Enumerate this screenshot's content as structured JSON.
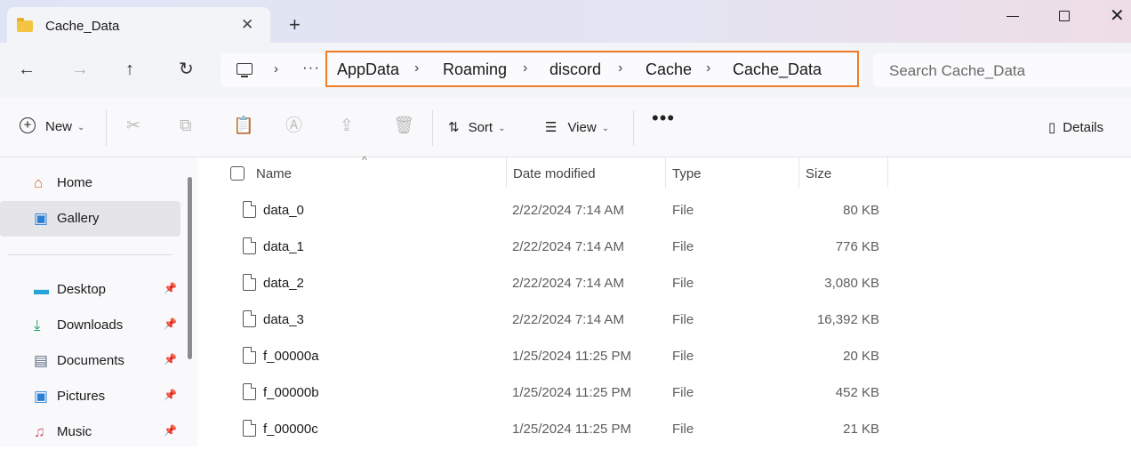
{
  "tab": {
    "title": "Cache_Data",
    "close": "✕",
    "new_tab": "+"
  },
  "window": {
    "close": "✕"
  },
  "nav": {
    "back": "←",
    "forward": "→",
    "up": "↑",
    "refresh": "↻",
    "sep": "›",
    "more": "···"
  },
  "breadcrumb": [
    "AppData",
    "Roaming",
    "discord",
    "Cache",
    "Cache_Data"
  ],
  "breadcrumb_sep": "›",
  "search": {
    "placeholder": "Search Cache_Data"
  },
  "toolbar": {
    "new_label": "New",
    "sort_label": "Sort",
    "view_label": "View",
    "more": "•••",
    "details_label": "Details",
    "caret": "⌄"
  },
  "sidebar": {
    "items": [
      {
        "label": "Home",
        "icon": "home-icon",
        "pinned": false
      },
      {
        "label": "Gallery",
        "icon": "gallery-icon",
        "pinned": false,
        "selected": true
      },
      {
        "label": "Desktop",
        "icon": "desktop-icon",
        "pinned": true
      },
      {
        "label": "Downloads",
        "icon": "downloads-icon",
        "pinned": true
      },
      {
        "label": "Documents",
        "icon": "documents-icon",
        "pinned": true
      },
      {
        "label": "Pictures",
        "icon": "pictures-icon",
        "pinned": true
      },
      {
        "label": "Music",
        "icon": "music-icon",
        "pinned": true
      }
    ]
  },
  "columns": {
    "name": "Name",
    "date": "Date modified",
    "type": "Type",
    "size": "Size"
  },
  "files": [
    {
      "name": "data_0",
      "date": "2/22/2024 7:14 AM",
      "type": "File",
      "size": "80 KB"
    },
    {
      "name": "data_1",
      "date": "2/22/2024 7:14 AM",
      "type": "File",
      "size": "776 KB"
    },
    {
      "name": "data_2",
      "date": "2/22/2024 7:14 AM",
      "type": "File",
      "size": "3,080 KB"
    },
    {
      "name": "data_3",
      "date": "2/22/2024 7:14 AM",
      "type": "File",
      "size": "16,392 KB"
    },
    {
      "name": "f_00000a",
      "date": "1/25/2024 11:25 PM",
      "type": "File",
      "size": "20 KB"
    },
    {
      "name": "f_00000b",
      "date": "1/25/2024 11:25 PM",
      "type": "File",
      "size": "452 KB"
    },
    {
      "name": "f_00000c",
      "date": "1/25/2024 11:25 PM",
      "type": "File",
      "size": "21 KB"
    }
  ],
  "colors": {
    "highlight_border": "#f07c28",
    "folder": "#f4c542"
  }
}
